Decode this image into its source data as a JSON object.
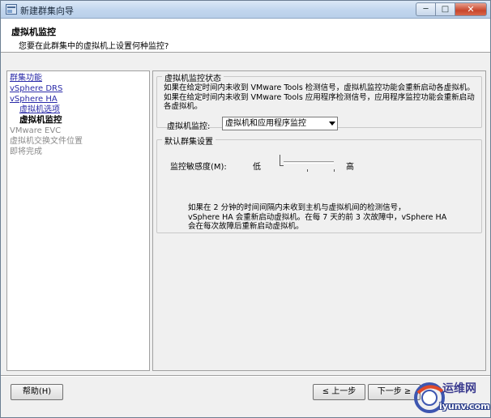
{
  "window": {
    "title": "新建群集向导",
    "controls": {
      "minimize": "─",
      "maximize": "□",
      "close": "✕"
    }
  },
  "header": {
    "title": "虚拟机监控",
    "subtitle": "您要在此群集中的虚拟机上设置何种监控?"
  },
  "nav": {
    "items": [
      {
        "label": "群集功能"
      },
      {
        "label": "vSphere DRS"
      },
      {
        "label": "vSphere HA"
      },
      {
        "label": "虚拟机选项"
      },
      {
        "label": "虚拟机监控"
      },
      {
        "label": "VMware EVC"
      },
      {
        "label": "虚拟机交换文件位置"
      },
      {
        "label": "即将完成"
      }
    ]
  },
  "vm_monitoring": {
    "legend": "虚拟机监控状态",
    "desc_lines": [
      "如果在给定时间内未收到 VMware Tools 检测信号，虚拟机监控功能会重新启动各虚拟机。",
      "如果在给定时间内未收到 VMware Tools 应用程序检测信号，应用程序监控功能会重新启动",
      "各虚拟机。"
    ],
    "label": "虚拟机监控:",
    "selected": "虚拟机和应用程序监控"
  },
  "default_settings": {
    "legend": "默认群集设置",
    "sensitivity_label": "监控敏感度(M):",
    "low": "低",
    "high": "高",
    "result_lines": [
      "如果在 2 分钟的时间间隔内未收到主机与虚拟机间的检测信号，",
      "vSphere HA 会重新启动虚拟机。在每 7 天的前 3 次故障中，vSphere HA",
      "会在每次故障后重新启动虚拟机。"
    ]
  },
  "buttons": {
    "help": "帮助(H)",
    "back": "≤ 上一步",
    "next": "下一步 ≥"
  },
  "watermark": {
    "logo": "运维网",
    "url": "iyunv.com"
  }
}
